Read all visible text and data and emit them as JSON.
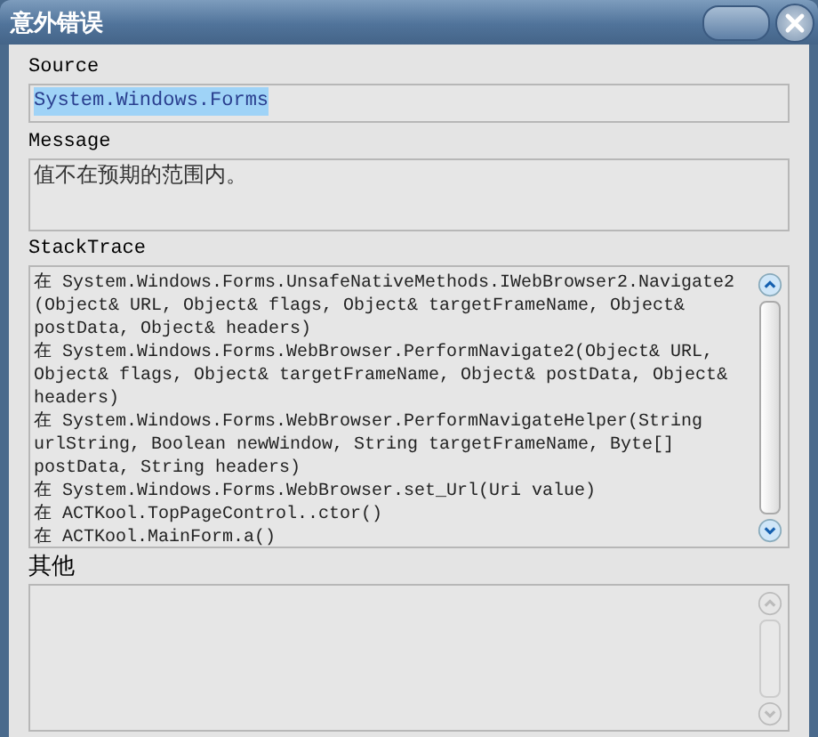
{
  "window": {
    "title": "意外错误"
  },
  "fields": [
    {
      "label": "Source",
      "kind": "single",
      "value_selected": true,
      "lines": [
        "System.Windows.Forms"
      ]
    },
    {
      "label": "Message",
      "kind": "multi",
      "lines": [
        "值不在预期的范围内。"
      ]
    },
    {
      "label": "StackTrace",
      "kind": "scroll",
      "scroll_disabled": false,
      "lines": [
        "在 System.Windows.Forms.UnsafeNativeMethods.IWebBrowser2.Navigate2",
        "(Object& URL, Object& flags, Object& targetFrameName, Object&",
        "postData, Object& headers)",
        "在 System.Windows.Forms.WebBrowser.PerformNavigate2(Object& URL,",
        "Object& flags, Object& targetFrameName, Object& postData, Object&",
        "headers)",
        "在 System.Windows.Forms.WebBrowser.PerformNavigateHelper(String",
        "urlString, Boolean newWindow, String targetFrameName, Byte[]",
        "postData, String headers)",
        "在 System.Windows.Forms.WebBrowser.set_Url(Uri value)",
        "在 ACTKool.TopPageControl..ctor()",
        "在 ACTKool.MainForm.a()"
      ]
    },
    {
      "label": "其他",
      "kind": "scroll",
      "scroll_disabled": true
    }
  ]
}
